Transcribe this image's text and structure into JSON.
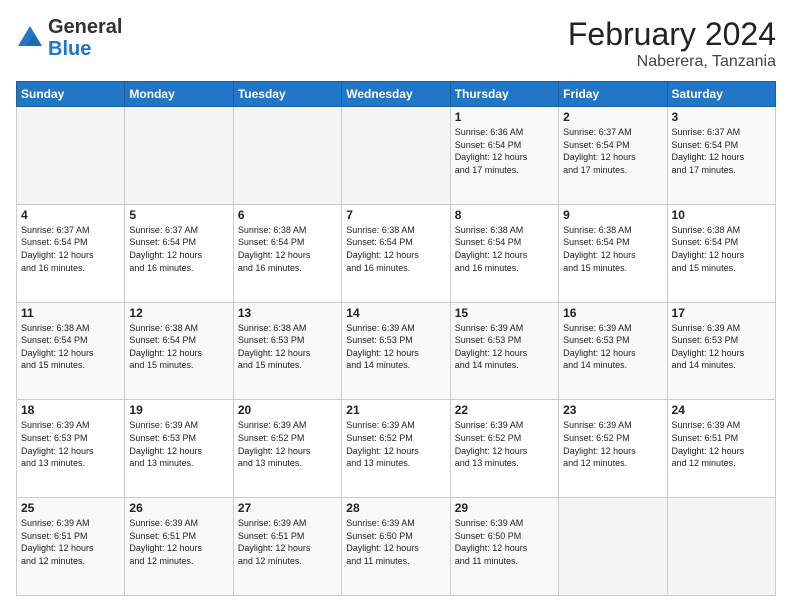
{
  "header": {
    "logo_general": "General",
    "logo_blue": "Blue",
    "month_year": "February 2024",
    "location": "Naberera, Tanzania"
  },
  "days_of_week": [
    "Sunday",
    "Monday",
    "Tuesday",
    "Wednesday",
    "Thursday",
    "Friday",
    "Saturday"
  ],
  "weeks": [
    [
      {
        "day": "",
        "info": ""
      },
      {
        "day": "",
        "info": ""
      },
      {
        "day": "",
        "info": ""
      },
      {
        "day": "",
        "info": ""
      },
      {
        "day": "1",
        "info": "Sunrise: 6:36 AM\nSunset: 6:54 PM\nDaylight: 12 hours\nand 17 minutes."
      },
      {
        "day": "2",
        "info": "Sunrise: 6:37 AM\nSunset: 6:54 PM\nDaylight: 12 hours\nand 17 minutes."
      },
      {
        "day": "3",
        "info": "Sunrise: 6:37 AM\nSunset: 6:54 PM\nDaylight: 12 hours\nand 17 minutes."
      }
    ],
    [
      {
        "day": "4",
        "info": "Sunrise: 6:37 AM\nSunset: 6:54 PM\nDaylight: 12 hours\nand 16 minutes."
      },
      {
        "day": "5",
        "info": "Sunrise: 6:37 AM\nSunset: 6:54 PM\nDaylight: 12 hours\nand 16 minutes."
      },
      {
        "day": "6",
        "info": "Sunrise: 6:38 AM\nSunset: 6:54 PM\nDaylight: 12 hours\nand 16 minutes."
      },
      {
        "day": "7",
        "info": "Sunrise: 6:38 AM\nSunset: 6:54 PM\nDaylight: 12 hours\nand 16 minutes."
      },
      {
        "day": "8",
        "info": "Sunrise: 6:38 AM\nSunset: 6:54 PM\nDaylight: 12 hours\nand 16 minutes."
      },
      {
        "day": "9",
        "info": "Sunrise: 6:38 AM\nSunset: 6:54 PM\nDaylight: 12 hours\nand 15 minutes."
      },
      {
        "day": "10",
        "info": "Sunrise: 6:38 AM\nSunset: 6:54 PM\nDaylight: 12 hours\nand 15 minutes."
      }
    ],
    [
      {
        "day": "11",
        "info": "Sunrise: 6:38 AM\nSunset: 6:54 PM\nDaylight: 12 hours\nand 15 minutes."
      },
      {
        "day": "12",
        "info": "Sunrise: 6:38 AM\nSunset: 6:54 PM\nDaylight: 12 hours\nand 15 minutes."
      },
      {
        "day": "13",
        "info": "Sunrise: 6:38 AM\nSunset: 6:53 PM\nDaylight: 12 hours\nand 15 minutes."
      },
      {
        "day": "14",
        "info": "Sunrise: 6:39 AM\nSunset: 6:53 PM\nDaylight: 12 hours\nand 14 minutes."
      },
      {
        "day": "15",
        "info": "Sunrise: 6:39 AM\nSunset: 6:53 PM\nDaylight: 12 hours\nand 14 minutes."
      },
      {
        "day": "16",
        "info": "Sunrise: 6:39 AM\nSunset: 6:53 PM\nDaylight: 12 hours\nand 14 minutes."
      },
      {
        "day": "17",
        "info": "Sunrise: 6:39 AM\nSunset: 6:53 PM\nDaylight: 12 hours\nand 14 minutes."
      }
    ],
    [
      {
        "day": "18",
        "info": "Sunrise: 6:39 AM\nSunset: 6:53 PM\nDaylight: 12 hours\nand 13 minutes."
      },
      {
        "day": "19",
        "info": "Sunrise: 6:39 AM\nSunset: 6:53 PM\nDaylight: 12 hours\nand 13 minutes."
      },
      {
        "day": "20",
        "info": "Sunrise: 6:39 AM\nSunset: 6:52 PM\nDaylight: 12 hours\nand 13 minutes."
      },
      {
        "day": "21",
        "info": "Sunrise: 6:39 AM\nSunset: 6:52 PM\nDaylight: 12 hours\nand 13 minutes."
      },
      {
        "day": "22",
        "info": "Sunrise: 6:39 AM\nSunset: 6:52 PM\nDaylight: 12 hours\nand 13 minutes."
      },
      {
        "day": "23",
        "info": "Sunrise: 6:39 AM\nSunset: 6:52 PM\nDaylight: 12 hours\nand 12 minutes."
      },
      {
        "day": "24",
        "info": "Sunrise: 6:39 AM\nSunset: 6:51 PM\nDaylight: 12 hours\nand 12 minutes."
      }
    ],
    [
      {
        "day": "25",
        "info": "Sunrise: 6:39 AM\nSunset: 6:51 PM\nDaylight: 12 hours\nand 12 minutes."
      },
      {
        "day": "26",
        "info": "Sunrise: 6:39 AM\nSunset: 6:51 PM\nDaylight: 12 hours\nand 12 minutes."
      },
      {
        "day": "27",
        "info": "Sunrise: 6:39 AM\nSunset: 6:51 PM\nDaylight: 12 hours\nand 12 minutes."
      },
      {
        "day": "28",
        "info": "Sunrise: 6:39 AM\nSunset: 6:50 PM\nDaylight: 12 hours\nand 11 minutes."
      },
      {
        "day": "29",
        "info": "Sunrise: 6:39 AM\nSunset: 6:50 PM\nDaylight: 12 hours\nand 11 minutes."
      },
      {
        "day": "",
        "info": ""
      },
      {
        "day": "",
        "info": ""
      }
    ]
  ]
}
